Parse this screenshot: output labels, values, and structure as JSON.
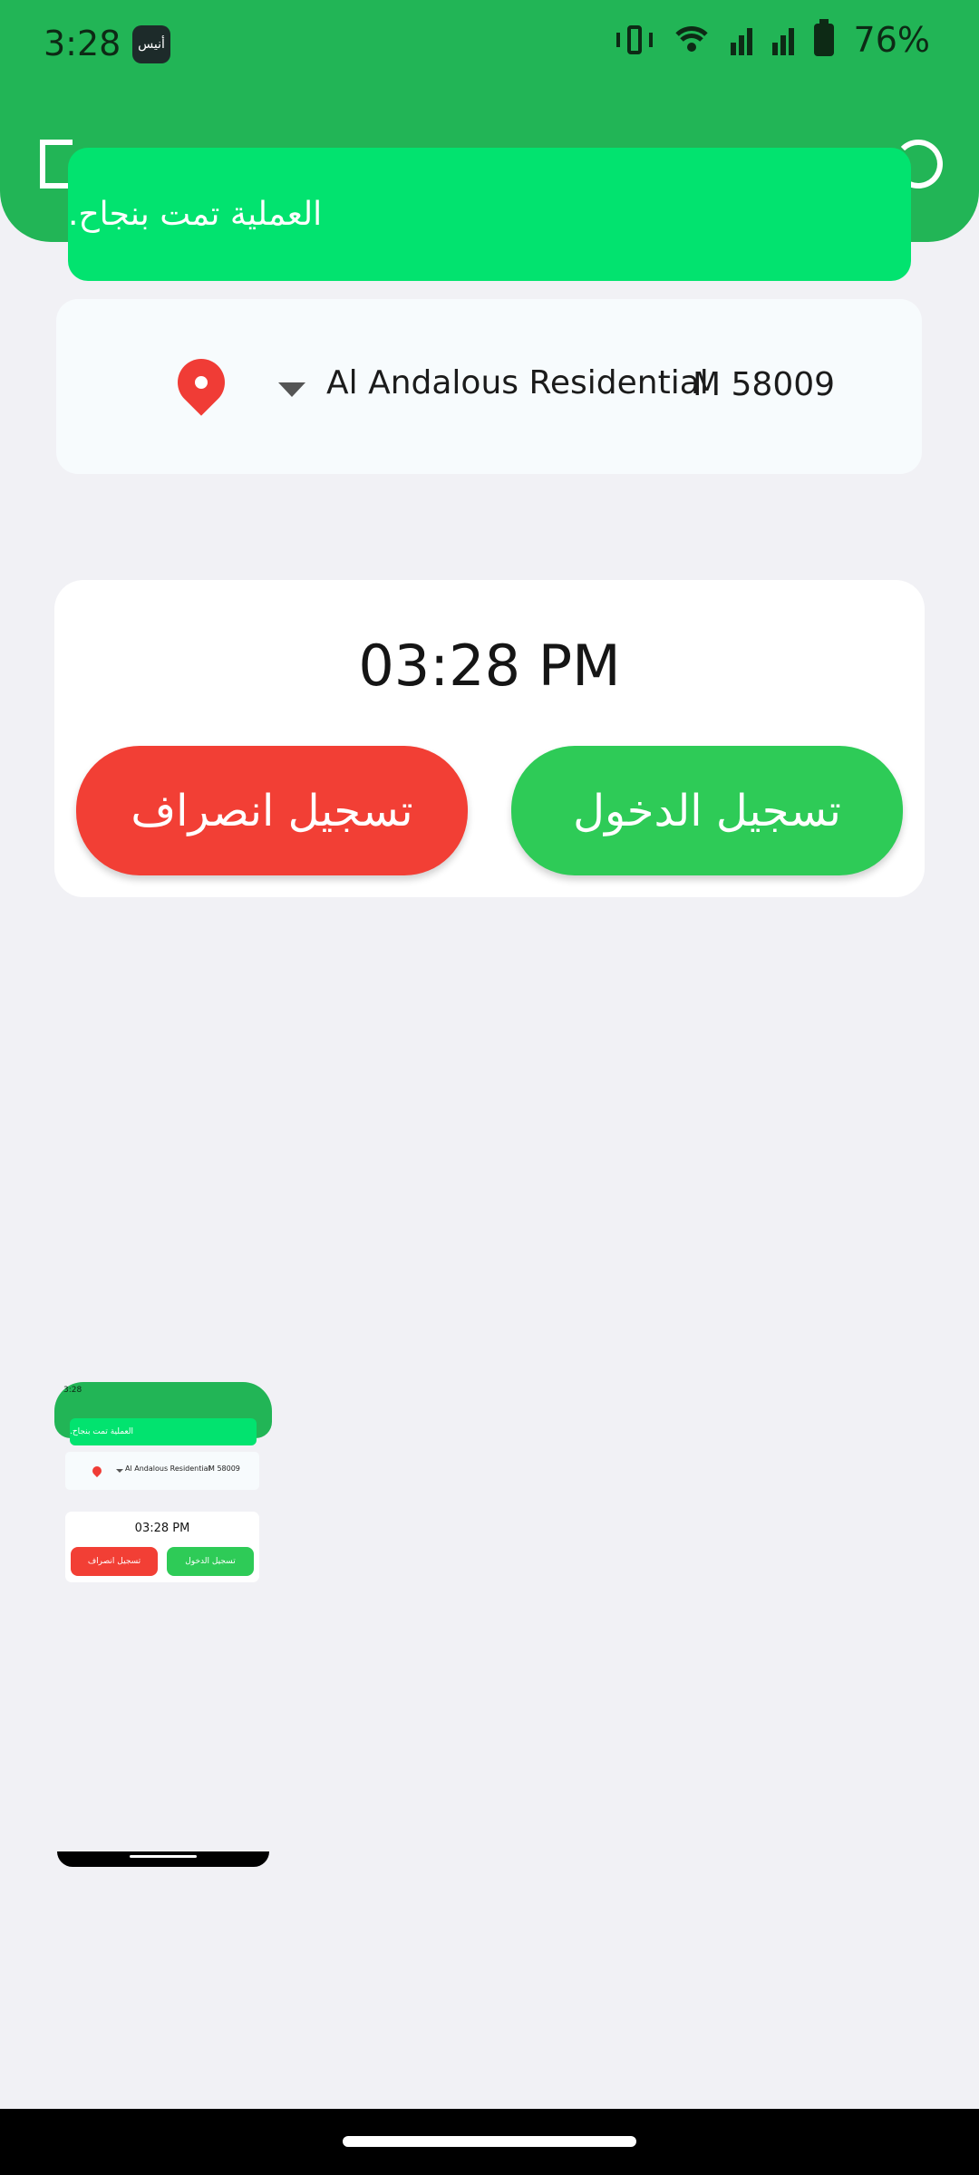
{
  "status_bar": {
    "time": "3:28",
    "app_badge": "أنيس",
    "battery": "76%"
  },
  "toast": {
    "message": "العملية تمت بنجاح."
  },
  "location": {
    "site_name": "Al Andalous Residential",
    "site_code": "M 58009"
  },
  "attendance": {
    "time": "03:28 PM",
    "check_out_label": "تسجيل انصراف",
    "check_in_label": "تسجيل الدخول"
  },
  "thumbnail": {
    "time": "3:28",
    "toast": "العملية تمت بنجاح.",
    "site_name": "Al Andalous Residential",
    "site_code": "M 58009",
    "clock": "03:28 PM",
    "check_out": "تسجيل انصراف",
    "check_in": "تسجيل الدخول"
  },
  "colors": {
    "header": "#22b556",
    "toast": "#02e36f",
    "check_out": "#f23f35",
    "check_in": "#2ecb57",
    "pin": "#f03c36"
  }
}
